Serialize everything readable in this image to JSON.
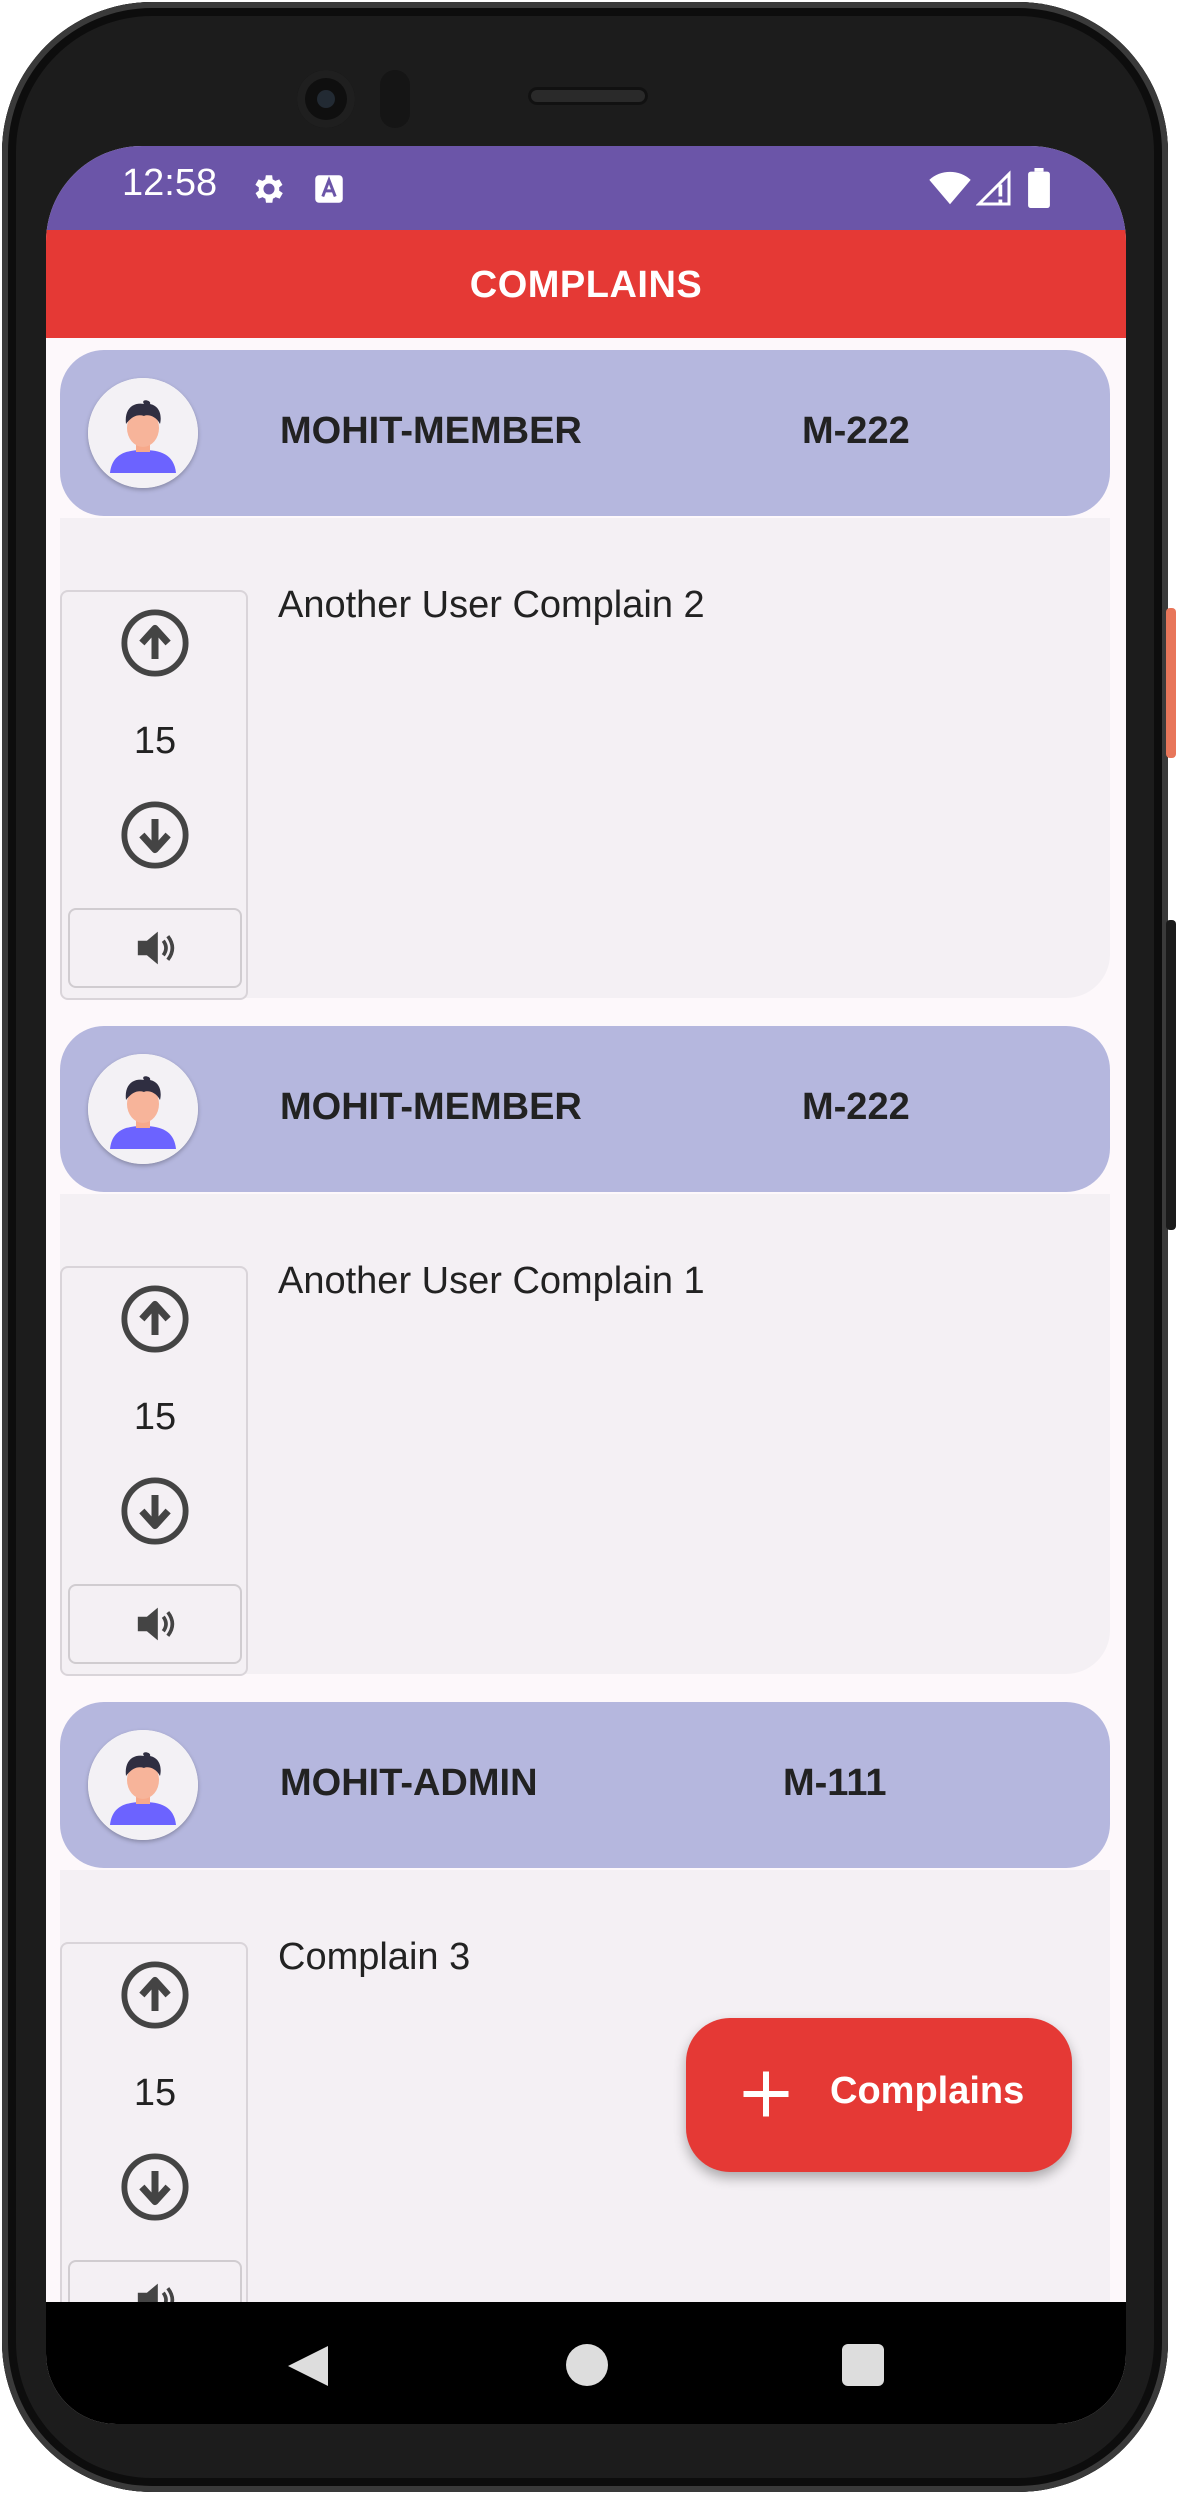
{
  "status_bar": {
    "time": "12:58",
    "icons": [
      "gear-icon",
      "a-icon",
      "wifi-icon",
      "signal-icon",
      "battery-icon"
    ]
  },
  "app_bar": {
    "title": "COMPLAINS"
  },
  "colors": {
    "status_bar": "#6b55a8",
    "app_bar": "#e53935",
    "card_header": "#b5b7de",
    "card_body": "#f4f0f4",
    "fab": "#e53935"
  },
  "complaints": [
    {
      "user": "MOHIT-MEMBER",
      "code": "M-222",
      "text": "Another User Complain 2",
      "votes": "15"
    },
    {
      "user": "MOHIT-MEMBER",
      "code": "M-222",
      "text": "Another User Complain 1",
      "votes": "15"
    },
    {
      "user": "MOHIT-ADMIN",
      "code": "M-111",
      "text": "Complain 3",
      "votes": "15"
    }
  ],
  "fab": {
    "label": "Complains",
    "icon": "plus-icon"
  },
  "nav_bar": {
    "icons": [
      "back-icon",
      "home-icon",
      "recents-icon"
    ]
  }
}
